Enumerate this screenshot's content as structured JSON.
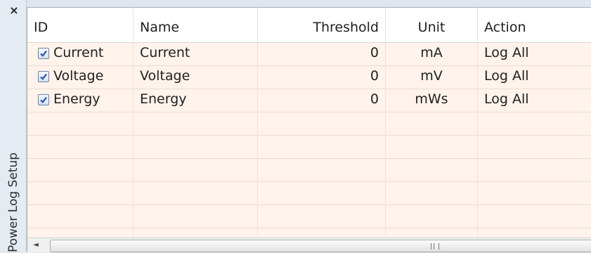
{
  "panel": {
    "title": "Power Log Setup",
    "close_glyph": "×"
  },
  "table": {
    "columns": [
      {
        "label": "ID"
      },
      {
        "label": "Name"
      },
      {
        "label": "Threshold"
      },
      {
        "label": "Unit"
      },
      {
        "label": "Action"
      }
    ],
    "rows": [
      {
        "id": "Current",
        "checked": true,
        "name": "Current",
        "threshold": "0",
        "unit": "mA",
        "action": "Log All"
      },
      {
        "id": "Voltage",
        "checked": true,
        "name": "Voltage",
        "threshold": "0",
        "unit": "mV",
        "action": "Log All"
      },
      {
        "id": "Energy",
        "checked": true,
        "name": "Energy",
        "threshold": "0",
        "unit": "mWs",
        "action": "Log All"
      }
    ],
    "empty_row_count": 6
  },
  "scrollbar": {
    "left_arrow_glyph": "◄",
    "thumb_grip": "grip"
  },
  "icons": {
    "checkbox": "checkbox-checked-icon",
    "close": "close-icon",
    "scroll_left": "scroll-left-arrow-icon"
  },
  "colors": {
    "row_background": "#fff3ec",
    "panel_background": "#e4ebf3",
    "checkbox_mark": "#2b56a8"
  }
}
